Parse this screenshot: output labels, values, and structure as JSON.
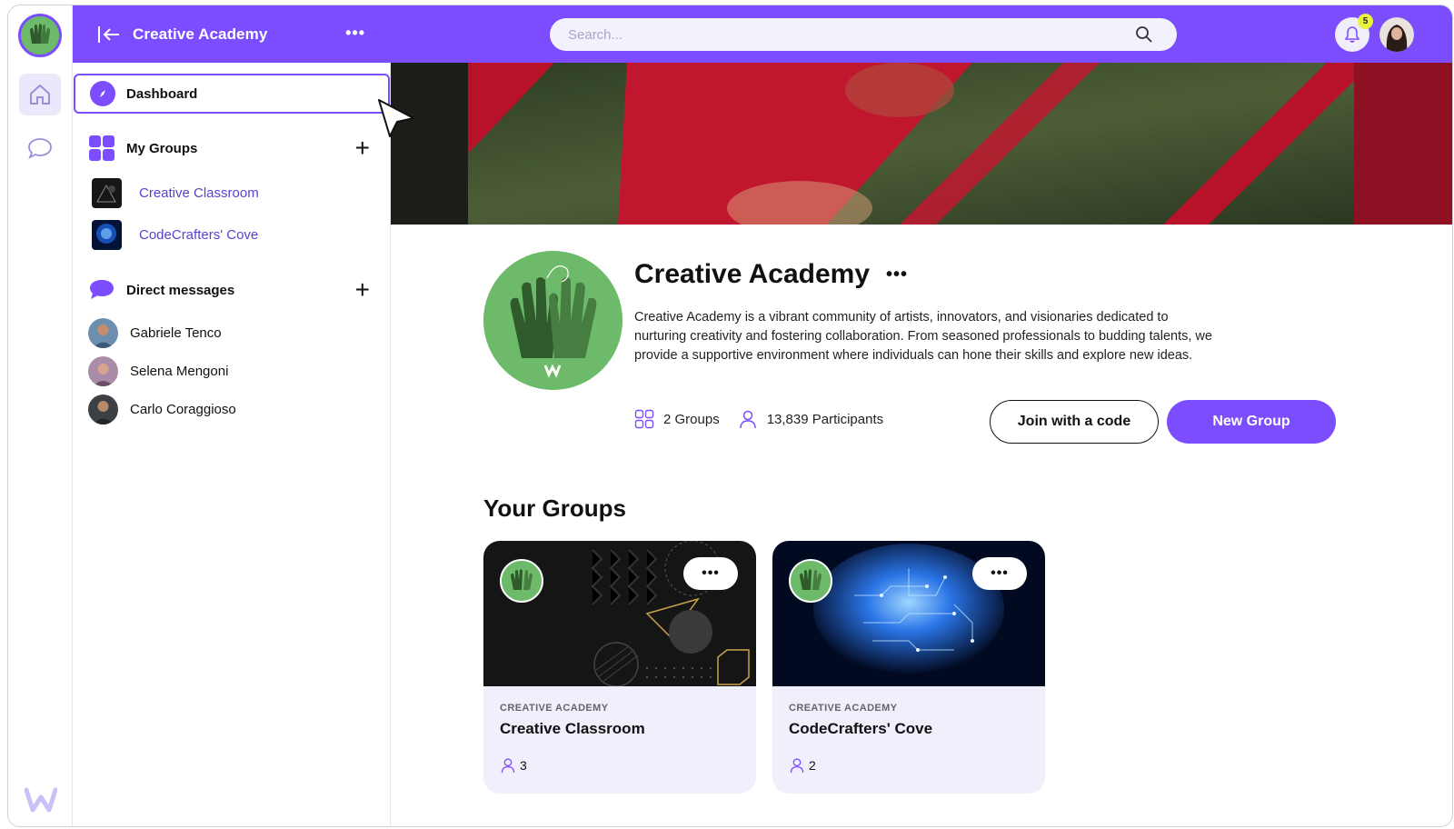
{
  "app": {
    "name": "Creative Academy",
    "accent": "#7c4dff"
  },
  "sidebar": {
    "title": "Creative Academy",
    "dashboard_label": "Dashboard",
    "my_groups_label": "My Groups",
    "groups": [
      {
        "label": "Creative Classroom"
      },
      {
        "label": "CodeCrafters' Cove"
      }
    ],
    "dm_label": "Direct messages",
    "contacts": [
      {
        "name": "Gabriele Tenco"
      },
      {
        "name": "Selena Mengoni"
      },
      {
        "name": "Carlo Coraggioso"
      }
    ]
  },
  "topbar": {
    "search_placeholder": "Search...",
    "notification_count": "5"
  },
  "community": {
    "title": "Creative Academy",
    "description": "Creative Academy is a vibrant community of artists, innovators, and visionaries dedicated to nurturing creativity and fostering collaboration. From seasoned professionals to budding talents, we provide a supportive environment where individuals can hone their skills and explore new ideas.",
    "groups_stat": "2 Groups",
    "participants_stat": "13,839 Participants",
    "join_label": "Join with a code",
    "new_group_label": "New Group"
  },
  "your_groups": {
    "title": "Your Groups",
    "cards": [
      {
        "org": "CREATIVE ACADEMY",
        "name": "Creative Classroom",
        "members": "3"
      },
      {
        "org": "CREATIVE ACADEMY",
        "name": "CodeCrafters' Cove",
        "members": "2"
      }
    ]
  },
  "icons": [
    "home-icon",
    "chat-icon",
    "back-icon",
    "compass-icon",
    "grid-icon",
    "chat-bubble-icon",
    "plus-icon",
    "search-icon",
    "bell-icon",
    "groups-icon",
    "user-icon",
    "more-icon"
  ]
}
